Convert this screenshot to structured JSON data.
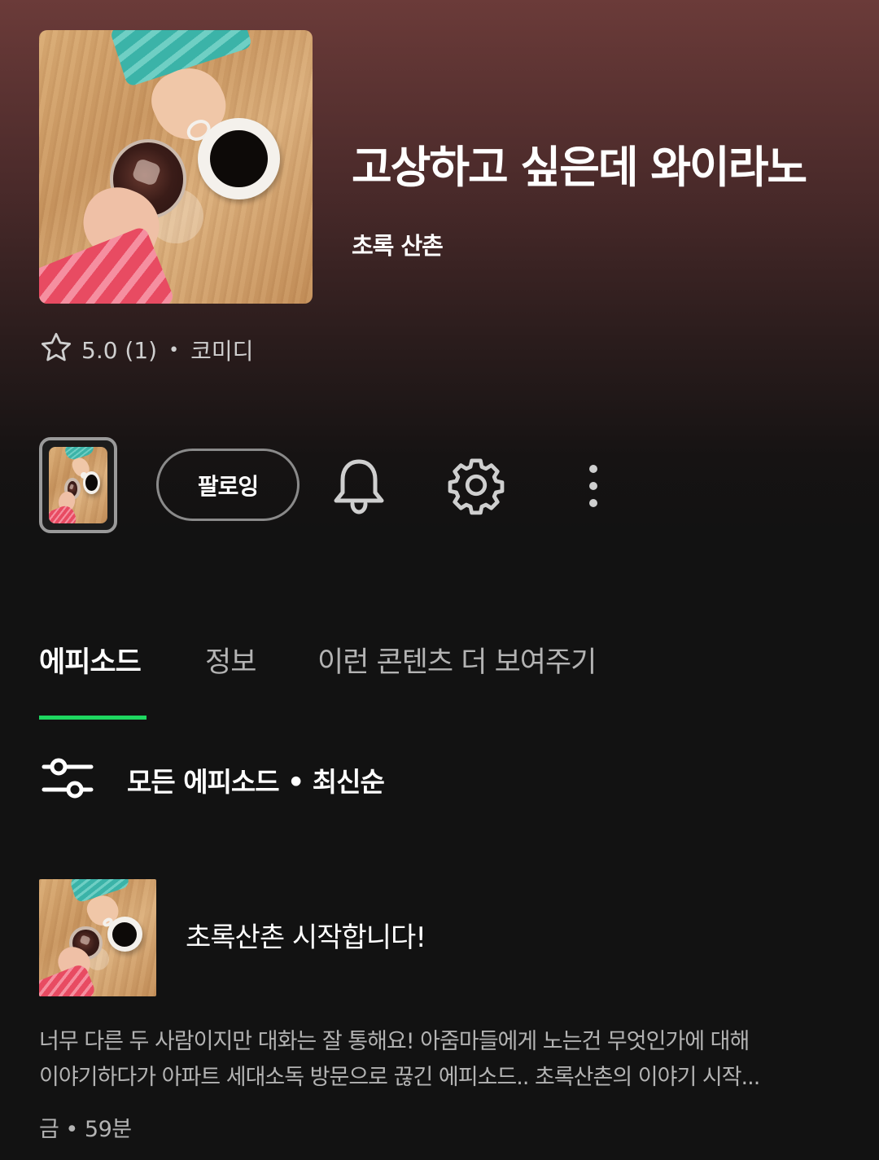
{
  "show": {
    "title": "고상하고 싶은데 와이라노",
    "author": "초록 산촌",
    "rating": "5.0 (1)",
    "separator": "•",
    "category": "코미디"
  },
  "actions": {
    "follow_label": "팔로잉"
  },
  "tabs": [
    {
      "label": "에피소드",
      "active": true
    },
    {
      "label": "정보",
      "active": false
    },
    {
      "label": "이런 콘텐츠 더 보여주기",
      "active": false
    }
  ],
  "filter": {
    "label": "모든 에피소드 • 최신순"
  },
  "episode": {
    "title": "초록산촌 시작합니다!",
    "description_lines": [
      "너무 다른 두 사람이지만 대화는 잘 통해요! 아줌마들에게 노는건 무엇인가에 대해",
      "이야기하다가 아파트 세대소독 방문으로 끊긴 에피소드.. 초록산촌의 이야기 시작..."
    ],
    "meta": "금 • 59분"
  },
  "icons": {
    "rating": "star-outline-icon",
    "notifications": "bell-icon",
    "settings": "gear-icon",
    "more": "more-vertical-icon",
    "filter": "filter-sliders-icon"
  },
  "colors": {
    "background": "#121212",
    "header_gradient_top": "#6b3b39",
    "accent": "#1ed760",
    "text_primary": "#ffffff",
    "text_secondary": "#b3b3b3"
  }
}
